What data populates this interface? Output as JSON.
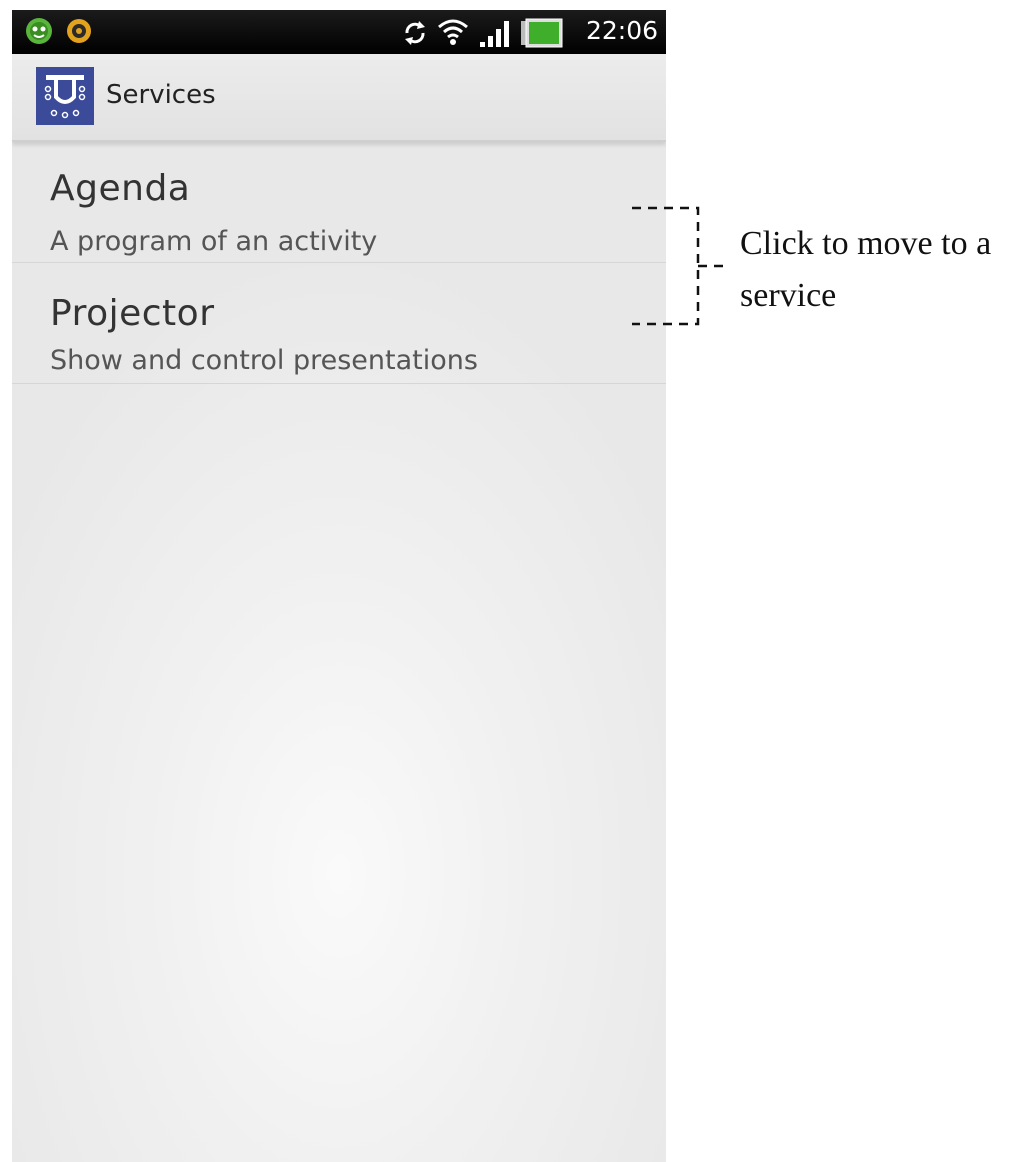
{
  "status_bar": {
    "time": "22:06",
    "left_icons": [
      "bug-face-icon",
      "target-app-icon"
    ],
    "right_icons": [
      "sync-icon",
      "wifi-icon",
      "signal-icon",
      "battery-icon"
    ]
  },
  "action_bar": {
    "title": "Services",
    "logo_icon": "projector-app-icon",
    "logo_color": "#3c4a9a"
  },
  "services": [
    {
      "title": "Agenda",
      "subtitle": "A program of an activity"
    },
    {
      "title": "Projector",
      "subtitle": "Show and control presentations"
    }
  ],
  "annotation": {
    "line1": "Click to move to a",
    "line2": "service"
  }
}
